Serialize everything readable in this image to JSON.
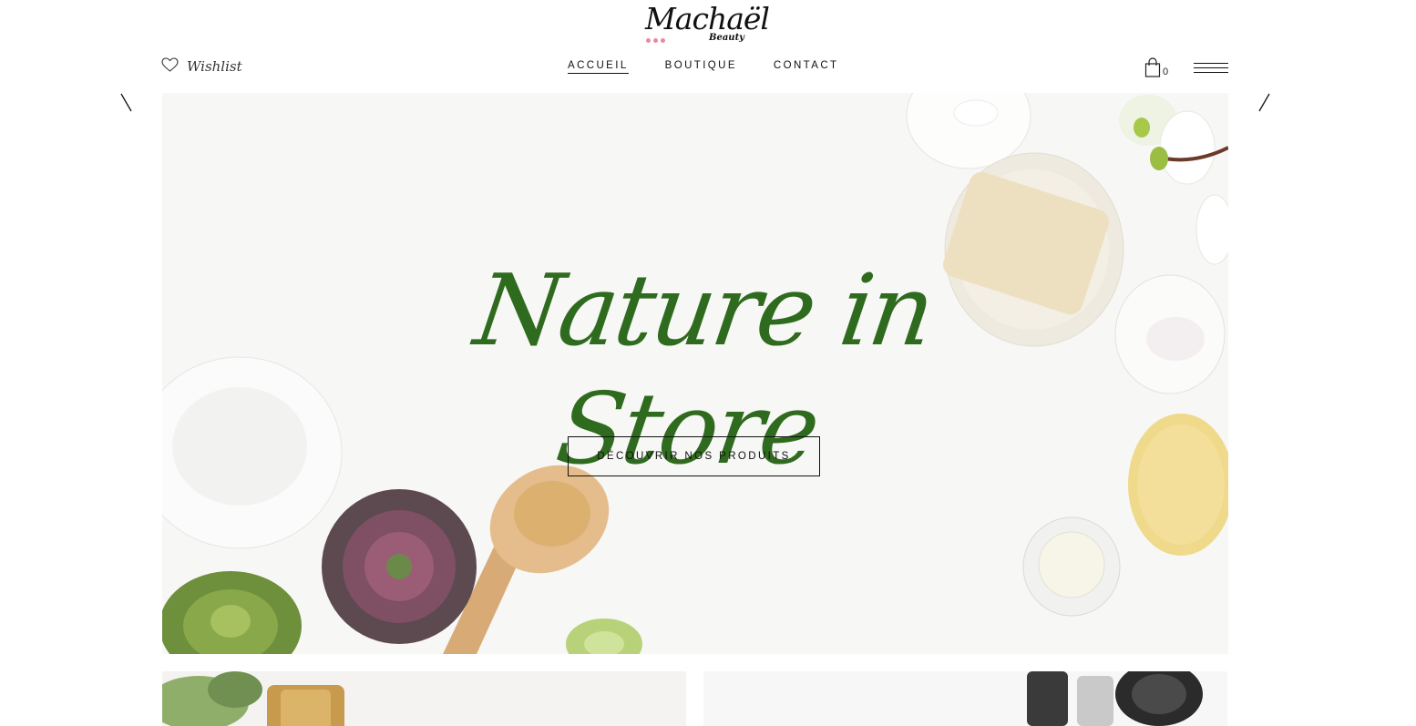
{
  "brand": {
    "name": "Machaël",
    "tagline": "Beauty",
    "dot_color": "#e98aa0"
  },
  "header": {
    "wishlist_label": "Wishlist",
    "nav": [
      {
        "label": "ACCUEIL",
        "active": true
      },
      {
        "label": "BOUTIQUE",
        "active": false
      },
      {
        "label": "CONTACT",
        "active": false
      }
    ],
    "cart_count": "0"
  },
  "icons": {
    "wishlist": "heart-icon",
    "cart": "shopping-bag-icon",
    "menu": "hamburger-menu-icon",
    "prev": "arrow-left-icon",
    "next": "arrow-right-icon"
  },
  "hero": {
    "title": "Nature in Store",
    "cta_label": "DÉCOUVRIR NOS PRODUITS",
    "title_color": "#2f6b1e"
  }
}
